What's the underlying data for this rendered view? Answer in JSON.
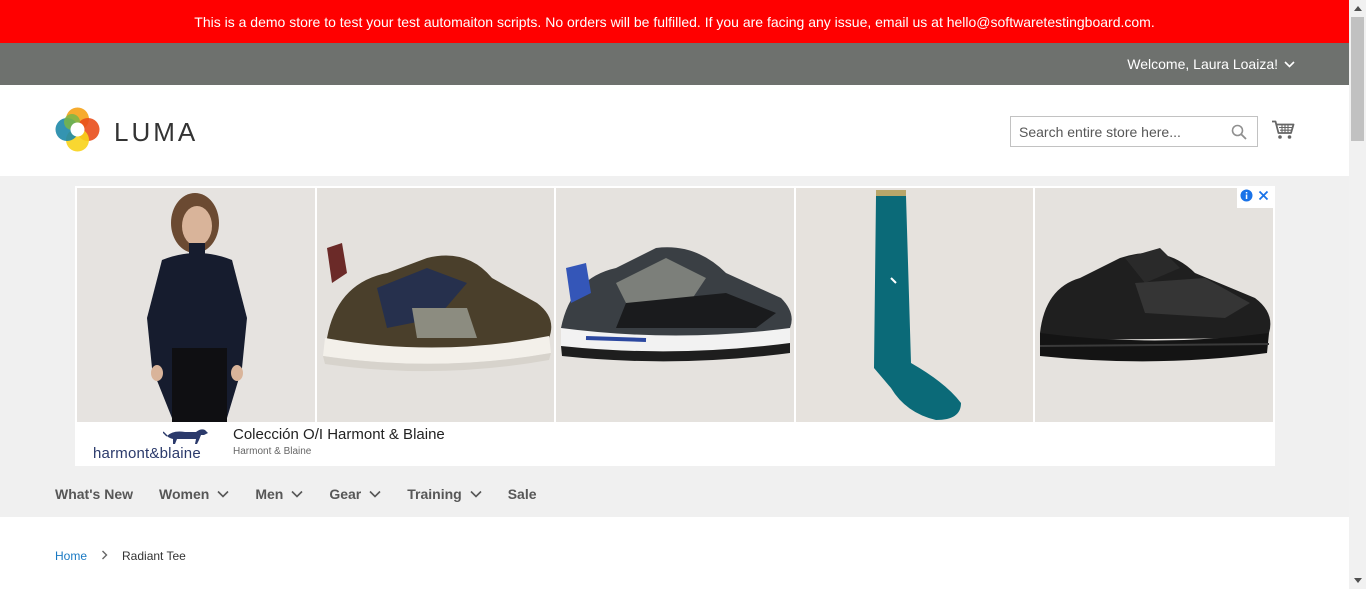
{
  "demo_banner": "This is a demo store to test your test automaiton scripts. No orders will be fulfilled. If you are facing any issue, email us at hello@softwaretestingboard.com.",
  "header_panel": {
    "welcome": "Welcome, Laura Loaiza!"
  },
  "logo": {
    "text": "LUMA"
  },
  "search": {
    "placeholder": "Search entire store here..."
  },
  "ad": {
    "brand": "harmont&blaine",
    "title": "Colección O/I Harmont & Blaine",
    "subtitle": "Harmont & Blaine"
  },
  "nav": {
    "items": [
      {
        "label": "What's New",
        "has_dropdown": false
      },
      {
        "label": "Women",
        "has_dropdown": true
      },
      {
        "label": "Men",
        "has_dropdown": true
      },
      {
        "label": "Gear",
        "has_dropdown": true
      },
      {
        "label": "Training",
        "has_dropdown": true
      },
      {
        "label": "Sale",
        "has_dropdown": false
      }
    ]
  },
  "breadcrumbs": {
    "home": "Home",
    "current": "Radiant Tee"
  },
  "colors": {
    "banner": "#ff0000",
    "panel": "#6e716e",
    "link": "#1979c3",
    "nav_bg": "#f0f0f0"
  }
}
